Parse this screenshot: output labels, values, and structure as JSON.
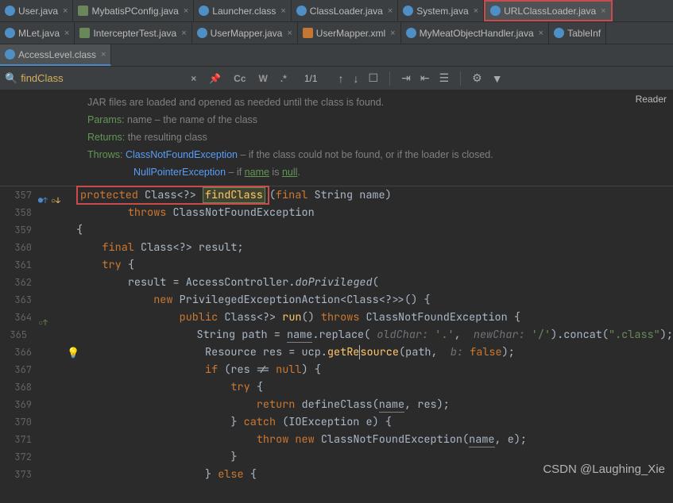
{
  "tabsRow1": [
    {
      "label": "User.java",
      "icon": "class"
    },
    {
      "label": "MybatisPConfig.java",
      "icon": "cfg"
    },
    {
      "label": "Launcher.class",
      "icon": "class"
    },
    {
      "label": "ClassLoader.java",
      "icon": "class"
    },
    {
      "label": "System.java",
      "icon": "class"
    },
    {
      "label": "URLClassLoader.java",
      "icon": "class",
      "highlight": true
    }
  ],
  "tabsRow2": [
    {
      "label": "MLet.java",
      "icon": "class"
    },
    {
      "label": "IntercepterTest.java",
      "icon": "cfg"
    },
    {
      "label": "UserMapper.java",
      "icon": "class"
    },
    {
      "label": "UserMapper.xml",
      "icon": "xml"
    },
    {
      "label": "MyMeatObjectHandler.java",
      "icon": "class"
    },
    {
      "label": "TableInf",
      "icon": "class",
      "noclose": true
    }
  ],
  "tabsRow3": [
    {
      "label": "AccessLevel.class",
      "icon": "class",
      "selected": true
    }
  ],
  "findbar": {
    "query": "findClass",
    "cc": "Cc",
    "w": "W",
    "regex": ".*",
    "match": "1/1"
  },
  "reader": "Reader",
  "doc": {
    "line1": "JAR files are loaded and opened as needed until the class is found.",
    "params": "Params:",
    "paramsTxt": "name – the name of the class",
    "returns": "Returns:",
    "returnsTxt": "the resulting class",
    "throws": "Throws:",
    "ex1": "ClassNotFoundException",
    "ex1Txt": " – if the class could not be found, or if the loader is closed.",
    "ex2": "NullPointerException",
    "ex2Txt": " – if ",
    "ex2Code": "name",
    "ex2Txt2": " is ",
    "ex2Code2": "null"
  },
  "lines": {
    "357": "357",
    "358": "358",
    "359": "359",
    "360": "360",
    "361": "361",
    "362": "362",
    "363": "363",
    "364": "364",
    "365": "365",
    "366": "366",
    "367": "367",
    "368": "368",
    "369": "369",
    "370": "370",
    "371": "371",
    "372": "372",
    "373": "373"
  },
  "code": {
    "l357a": "protected",
    "l357b": " Class<?> ",
    "l357c": "findClass",
    "l357d": "(",
    "l357e": "final",
    "l357f": " String name)",
    "l358a": "throws",
    "l358b": " ClassNotFoundException",
    "l359": "{",
    "l360a": "final",
    "l360b": " Class<?> result;",
    "l361a": "try",
    "l361b": " {",
    "l362a": "result = AccessController.",
    "l362b": "doPrivileged",
    "l362c": "(",
    "l363a": "new",
    "l363b": " PrivilegedExceptionAction<Class<?>>() {",
    "l364a": "public",
    "l364b": " Class<?> ",
    "l364c": "run",
    "l364d": "() ",
    "l364e": "throws",
    "l364f": " ClassNotFoundException {",
    "l365a": "String path = ",
    "l365n": "name",
    "l365b": ".replace(",
    "l365p1": " oldChar: ",
    "l365c": "'.'",
    "l365d": ", ",
    "l365p2": " newChar: ",
    "l365e": "'/'",
    "l365f": ").concat(",
    "l365g": "\".class\"",
    "l365h": ");",
    "l366a": "Resource res = ucp.",
    "l366b": "getRe",
    "l366c": "source",
    "l366d": "(path, ",
    "l366p": " b: ",
    "l366e": "false",
    "l366f": ");",
    "l367a": "if",
    "l367b": " (res != ",
    "l367c": "null",
    "l367d": ") {",
    "l368a": "try",
    "l368b": " {",
    "l369a": "return",
    "l369b": " defineClass(",
    "l369n": "name",
    "l369c": ", res);",
    "l370a": "} ",
    "l370b": "catch",
    "l370c": " (IOException e) {",
    "l371a": "throw new",
    "l371b": " ClassNotFoundException(",
    "l371n": "name",
    "l371c": ", e);",
    "l372": "}",
    "l373a": "} ",
    "l373b": "else",
    "l373c": " {"
  },
  "watermark": "CSDN @Laughing_Xie"
}
